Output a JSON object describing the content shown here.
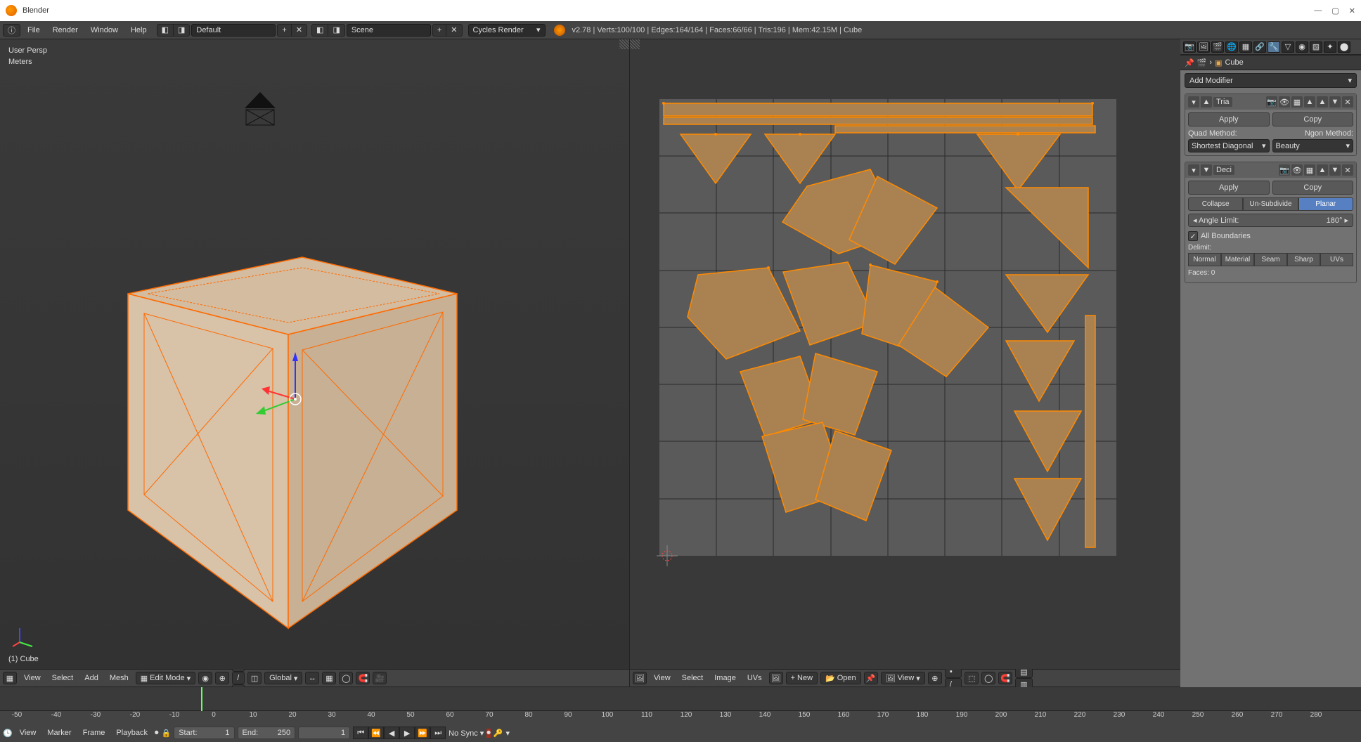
{
  "app": {
    "title": "Blender",
    "win_min": "—",
    "win_max": "▢",
    "win_close": "✕"
  },
  "topmenu": {
    "file": "File",
    "render": "Render",
    "window": "Window",
    "help": "Help",
    "layout": "Default",
    "scene": "Scene",
    "engine": "Cycles Render",
    "stats": "v2.78 | Verts:100/100 | Edges:164/164 | Faces:66/66 | Tris:196 | Mem:42.15M | Cube"
  },
  "view3d": {
    "persp": "User Persp",
    "units": "Meters",
    "obj": "(1) Cube",
    "header": {
      "view": "View",
      "select": "Select",
      "add": "Add",
      "mesh": "Mesh",
      "mode": "Edit Mode",
      "orient": "Global"
    }
  },
  "uv": {
    "header": {
      "view": "View",
      "select": "Select",
      "image": "Image",
      "uvs": "UVs",
      "new": "New",
      "open": "Open",
      "viewbtn": "View"
    }
  },
  "props": {
    "crumb": "Cube",
    "add_modifier": "Add Modifier",
    "mod1": {
      "name": "Tria",
      "apply": "Apply",
      "copy": "Copy",
      "quad_label": "Quad Method:",
      "ngon_label": "Ngon Method:",
      "quad": "Shortest Diagonal",
      "ngon": "Beauty"
    },
    "mod2": {
      "name": "Deci",
      "apply": "Apply",
      "copy": "Copy",
      "collapse": "Collapse",
      "unsubdivide": "Un-Subdivide",
      "planar": "Planar",
      "angle_label": "Angle Limit:",
      "angle_val": "180°",
      "all_boundaries": "All Boundaries",
      "delimit": "Delimit:",
      "normal": "Normal",
      "material": "Material",
      "seam": "Seam",
      "sharp": "Sharp",
      "uvs": "UVs",
      "faces": "Faces: 0"
    }
  },
  "timeline": {
    "ticks": [
      "-50",
      "-40",
      "-30",
      "-20",
      "-10",
      "0",
      "10",
      "20",
      "30",
      "40",
      "50",
      "60",
      "70",
      "80",
      "90",
      "100",
      "110",
      "120",
      "130",
      "140",
      "150",
      "160",
      "170",
      "180",
      "190",
      "200",
      "210",
      "220",
      "230",
      "240",
      "250",
      "260",
      "270",
      "280"
    ],
    "view": "View",
    "marker": "Marker",
    "frame": "Frame",
    "playback": "Playback",
    "start_label": "Start:",
    "start_val": "1",
    "end_label": "End:",
    "end_val": "250",
    "cur_val": "1",
    "sync": "No Sync"
  }
}
